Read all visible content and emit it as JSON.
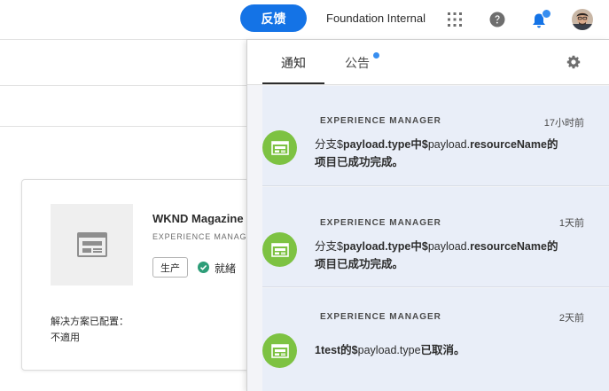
{
  "header": {
    "feedback_label": "反馈",
    "org_name": "Foundation Internal"
  },
  "card": {
    "title": "WKND Magazine",
    "subtitle": "EXPERIENCE MANAGER",
    "env_tag": "生产",
    "status": "就緒",
    "config_label": "解决方案已配置：",
    "config_value": "不適用"
  },
  "panel": {
    "tabs": [
      {
        "label": "通知"
      },
      {
        "label": "公告"
      }
    ],
    "notifications": [
      {
        "source": "EXPERIENCE MANAGER",
        "time": "17小时前",
        "parts": [
          "分支$",
          "payload.type",
          "中$",
          "payload.",
          "resourceName",
          "的"
        ],
        "line2": "项目已成功完成。"
      },
      {
        "source": "EXPERIENCE MANAGER",
        "time": "1天前",
        "parts": [
          "分支$",
          "payload.type",
          "中$",
          "payload.",
          "resourceName",
          "的"
        ],
        "line2": "项目已成功完成。"
      },
      {
        "source": "EXPERIENCE MANAGER",
        "time": "2天前",
        "parts": [
          "1test的$",
          "payload.type",
          "已取消。"
        ]
      }
    ]
  },
  "colors": {
    "accent": "#1473e6",
    "badge_dot": "#378ef0",
    "notification_icon": "#7dc242",
    "status_ok": "#2d9d78",
    "notification_bg": "#e9eef8"
  },
  "icons": [
    "apps-grid-icon",
    "help-icon",
    "bell-icon",
    "user-avatar",
    "gear-icon",
    "web-page-icon",
    "checkmark-circle-icon"
  ]
}
